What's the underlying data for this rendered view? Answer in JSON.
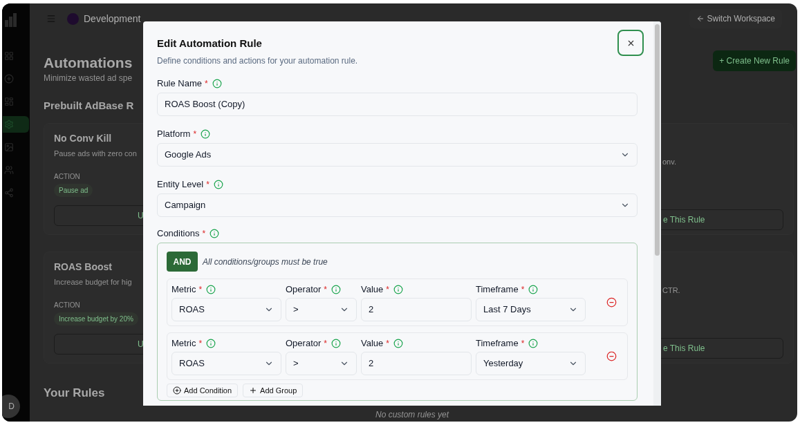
{
  "sidebar": {
    "items": [
      {
        "selected": false
      },
      {
        "selected": false
      },
      {
        "selected": false
      },
      {
        "selected": true
      },
      {
        "selected": false
      },
      {
        "selected": false
      },
      {
        "selected": false
      }
    ],
    "avatar": "D"
  },
  "header": {
    "workspace": "Development",
    "switch_button": "Switch Workspace"
  },
  "page": {
    "title": "Automations",
    "subtitle": "Minimize wasted ad spe",
    "create_button": "+ Create New Rule",
    "prebuilt_heading": "Prebuilt AdBase R",
    "card_rows": [
      {
        "left": {
          "title": "No Conv Kill",
          "description": "Pause ads with zero con",
          "action_label": "ACTION",
          "action": "Pause ad",
          "button": "U"
        },
        "right": {
          "description": "onv.",
          "button": "e This Rule"
        }
      },
      {
        "left": {
          "title": "ROAS Boost",
          "description": "Increase budget for hig",
          "action_label": "ACTION",
          "action": "Increase budget by 20%",
          "button": "U"
        },
        "right": {
          "description": "CTR.",
          "button": "e This Rule"
        }
      }
    ],
    "your_rules_heading": "Your Rules",
    "empty_text": "No custom rules yet"
  },
  "modal": {
    "title": "Edit Automation Rule",
    "subtitle": "Define conditions and actions for your automation rule.",
    "fields": [
      {
        "label": "Rule Name",
        "required_mark": "*",
        "kind": "input",
        "value": "ROAS Boost (Copy)"
      },
      {
        "label": "Platform",
        "required_mark": "*",
        "kind": "select",
        "value": "Google Ads"
      },
      {
        "label": "Entity Level",
        "required_mark": "*",
        "kind": "select",
        "value": "Campaign"
      }
    ],
    "conditions": {
      "label": "Conditions",
      "required_mark": "*",
      "logic": "AND",
      "logic_hint": "All conditions/groups must be true",
      "rows": [
        {
          "fields": [
            {
              "label": "Metric",
              "required_mark": "*",
              "kind": "select",
              "value": "ROAS"
            },
            {
              "label": "Operator",
              "required_mark": "*",
              "kind": "select",
              "value": ">"
            },
            {
              "label": "Value",
              "required_mark": "*",
              "kind": "input",
              "value": "2"
            },
            {
              "label": "Timeframe",
              "required_mark": "*",
              "kind": "select",
              "value": "Last 7 Days"
            }
          ]
        },
        {
          "fields": [
            {
              "label": "Metric",
              "required_mark": "*",
              "kind": "select",
              "value": "ROAS"
            },
            {
              "label": "Operator",
              "required_mark": "*",
              "kind": "select",
              "value": ">"
            },
            {
              "label": "Value",
              "required_mark": "*",
              "kind": "input",
              "value": "2"
            },
            {
              "label": "Timeframe",
              "required_mark": "*",
              "kind": "select",
              "value": "Yesterday"
            }
          ]
        }
      ],
      "add_condition": "Add Condition",
      "add_group": "Add Group"
    }
  }
}
